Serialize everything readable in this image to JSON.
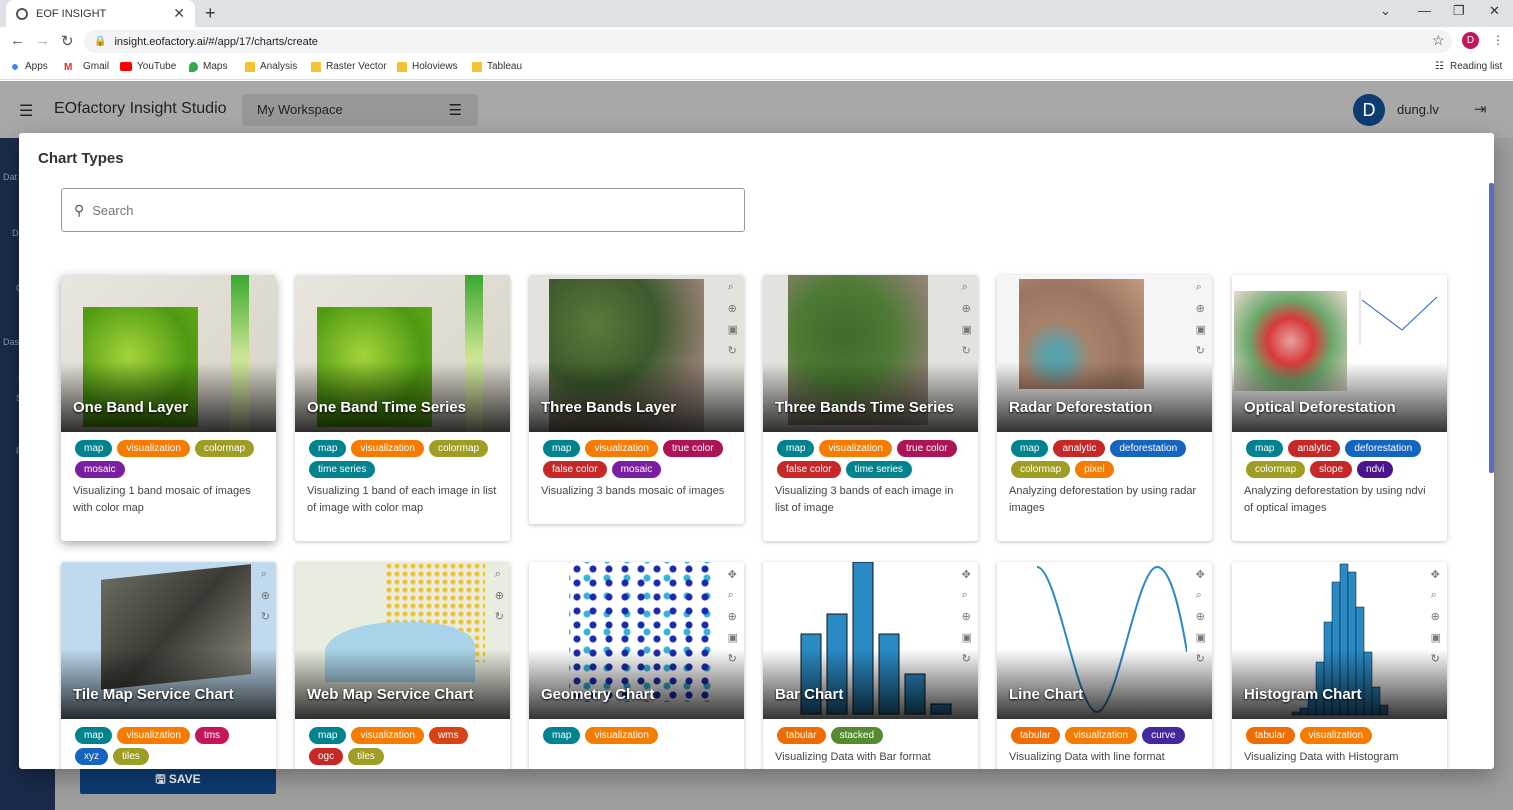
{
  "browser": {
    "tab_title": "EOF INSIGHT",
    "url": "insight.eofactory.ai/#/app/17/charts/create",
    "profile_initial": "D",
    "bookmarks": [
      "Apps",
      "Gmail",
      "YouTube",
      "Maps",
      "Analysis",
      "Raster Vector",
      "Holoviews",
      "Tableau"
    ],
    "reading_list": "Reading list"
  },
  "app": {
    "title": "EOfactory Insight Studio",
    "workspace": "My Workspace",
    "user_initial": "D",
    "username": "dung.lv",
    "save_label": "SAVE",
    "side_labels": [
      "Dat",
      "D",
      "C",
      "Das",
      "I",
      "S",
      "F"
    ]
  },
  "dialog": {
    "title": "Chart Types",
    "search_placeholder": "Search",
    "cards": [
      {
        "title": "One Band Layer",
        "tags": [
          [
            "map",
            "t-map"
          ],
          [
            "visualization",
            "t-vis"
          ],
          [
            "colormap",
            "t-colormap"
          ],
          [
            "mosaic",
            "t-mosaic"
          ]
        ],
        "desc": "Visualizing 1 band mosaic of images with color map"
      },
      {
        "title": "One Band Time Series",
        "tags": [
          [
            "map",
            "t-map"
          ],
          [
            "visualization",
            "t-vis"
          ],
          [
            "colormap",
            "t-colormap"
          ],
          [
            "time series",
            "t-ts"
          ]
        ],
        "desc": "Visualizing 1 band of each image in list of image with color map"
      },
      {
        "title": "Three Bands Layer",
        "tags": [
          [
            "map",
            "t-map"
          ],
          [
            "visualization",
            "t-vis"
          ],
          [
            "true color",
            "t-true"
          ],
          [
            "false color",
            "t-false"
          ],
          [
            "mosaic",
            "t-mosaic"
          ]
        ],
        "desc": "Visualizing 3 bands mosaic of images"
      },
      {
        "title": "Three Bands Time Series",
        "tags": [
          [
            "map",
            "t-map"
          ],
          [
            "visualization",
            "t-vis"
          ],
          [
            "true color",
            "t-true"
          ],
          [
            "false color",
            "t-false"
          ],
          [
            "time series",
            "t-ts"
          ]
        ],
        "desc": "Visualizing 3 bands of each image in list of image"
      },
      {
        "title": "Radar Deforestation",
        "tags": [
          [
            "map",
            "t-map"
          ],
          [
            "analytic",
            "t-analytic"
          ],
          [
            "deforestation",
            "t-defor"
          ],
          [
            "colormap",
            "t-colormap"
          ],
          [
            "pixel",
            "t-pixel"
          ]
        ],
        "desc": "Analyzing deforestation by using radar images"
      },
      {
        "title": "Optical Deforestation",
        "tags": [
          [
            "map",
            "t-map"
          ],
          [
            "analytic",
            "t-analytic"
          ],
          [
            "deforestation",
            "t-defor"
          ],
          [
            "colormap",
            "t-colormap"
          ],
          [
            "slope",
            "t-slope"
          ],
          [
            "ndvi",
            "t-ndvi"
          ]
        ],
        "desc": "Analyzing deforestation by using ndvi of optical images"
      },
      {
        "title": "Tile Map Service Chart",
        "tags": [
          [
            "map",
            "t-map"
          ],
          [
            "visualization",
            "t-vis"
          ],
          [
            "tms",
            "t-tms"
          ],
          [
            "xyz",
            "t-defor"
          ],
          [
            "tiles",
            "t-colormap"
          ]
        ],
        "desc": ""
      },
      {
        "title": "Web Map Service Chart",
        "tags": [
          [
            "map",
            "t-map"
          ],
          [
            "visualization",
            "t-vis"
          ],
          [
            "wms",
            "t-wms"
          ],
          [
            "ogc",
            "t-analytic"
          ],
          [
            "tiles",
            "t-colormap"
          ]
        ],
        "desc": ""
      },
      {
        "title": "Geometry Chart",
        "tags": [
          [
            "map",
            "t-map"
          ],
          [
            "visualization",
            "t-vis"
          ]
        ],
        "desc": ""
      },
      {
        "title": "Bar Chart",
        "tags": [
          [
            "tabular",
            "t-tab"
          ],
          [
            "stacked",
            "t-stacked"
          ]
        ],
        "desc": "Visualizing Data with Bar format"
      },
      {
        "title": "Line Chart",
        "tags": [
          [
            "tabular",
            "t-tab"
          ],
          [
            "visualization",
            "t-vis"
          ],
          [
            "curve",
            "t-curve"
          ]
        ],
        "desc": "Visualizing Data with line format"
      },
      {
        "title": "Histogram Chart",
        "tags": [
          [
            "tabular",
            "t-tab"
          ],
          [
            "visualization",
            "t-vis"
          ]
        ],
        "desc": "Visualizing Data with Histogram"
      }
    ]
  }
}
